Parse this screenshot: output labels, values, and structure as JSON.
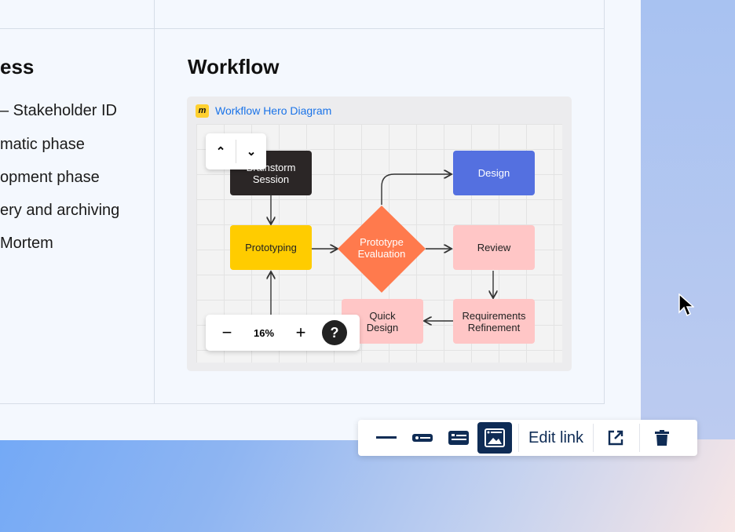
{
  "page": {
    "left_heading": "ess",
    "left_items": [
      "– Stakeholder ID",
      "matic phase",
      "opment phase",
      "ery and archiving",
      "Mortem"
    ],
    "right_heading": "Workflow"
  },
  "embed": {
    "title": "Workflow Hero Diagram",
    "nodes": {
      "brainstorm": "Brainstorm Session",
      "design": "Design",
      "prototyping": "Prototyping",
      "evaluation": "Prototype Evaluation",
      "review": "Review",
      "quick_design": "Quick Design",
      "requirements": "Requirements Refinement"
    },
    "zoom_level": "16%",
    "help": "?"
  },
  "toolbar": {
    "edit_link": "Edit link",
    "active_view": "embed-card"
  },
  "colors": {
    "brainstorm": "#2b2626",
    "design": "#5470e0",
    "prototyping": "#ffcc00",
    "evaluation": "#ff7a4d",
    "pink": "#ffc6c6",
    "toolbar_icon": "#0f2c55"
  }
}
